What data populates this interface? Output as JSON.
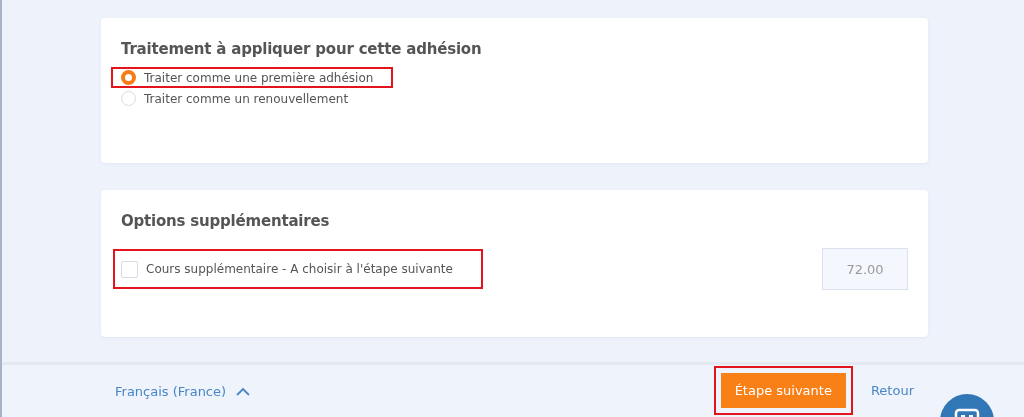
{
  "treatment": {
    "title": "Traitement à appliquer pour cette adhésion",
    "options": [
      {
        "label": "Traiter comme une première adhésion",
        "selected": true,
        "highlighted": true
      },
      {
        "label": "Traiter comme un renouvellement",
        "selected": false,
        "highlighted": false
      }
    ]
  },
  "extras": {
    "title": "Options supplémentaires",
    "options": [
      {
        "label": "Cours supplémentaire - A choisir à l'étape suivante",
        "checked": false,
        "highlighted": true,
        "price": "72.00"
      }
    ]
  },
  "footer": {
    "language": "Français (France)",
    "next_button": {
      "label": "Étape suivante",
      "highlighted": true
    },
    "back_link": "Retour"
  }
}
